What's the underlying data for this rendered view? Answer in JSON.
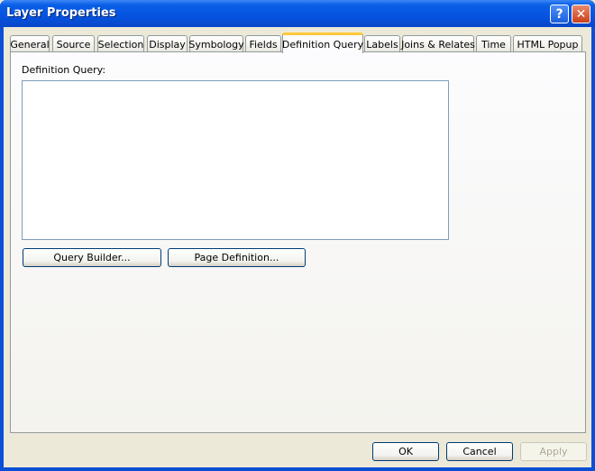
{
  "window": {
    "title": "Layer Properties",
    "help_glyph": "?",
    "close_glyph": "✕"
  },
  "tabs": [
    {
      "label": "General"
    },
    {
      "label": "Source"
    },
    {
      "label": "Selection"
    },
    {
      "label": "Display"
    },
    {
      "label": "Symbology"
    },
    {
      "label": "Fields"
    },
    {
      "label": "Definition Query",
      "active": true
    },
    {
      "label": "Labels"
    },
    {
      "label": "Joins & Relates"
    },
    {
      "label": "Time"
    },
    {
      "label": "HTML Popup"
    }
  ],
  "definition_query": {
    "label": "Definition Query:",
    "value": "",
    "query_builder_label": "Query Builder...",
    "page_definition_label": "Page Definition..."
  },
  "footer": {
    "ok_label": "OK",
    "cancel_label": "Cancel",
    "apply_label": "Apply"
  },
  "colors": {
    "title_bar": "#0553e0",
    "active_tab_accent": "#ffc83c",
    "dialog_bg": "#ece9d8"
  }
}
